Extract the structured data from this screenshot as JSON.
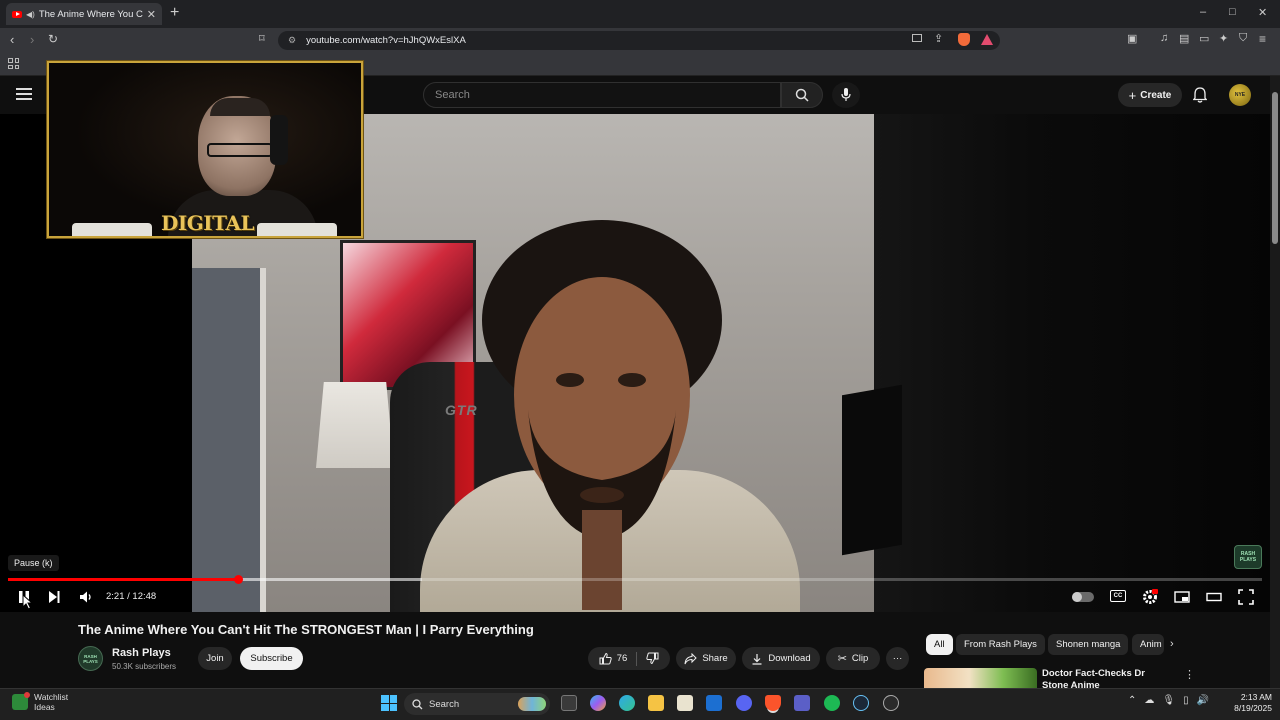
{
  "browser": {
    "tab_title": "The Anime Where You Can't Hit",
    "url": "youtube.com/watch?v=hJhQWxEslXA",
    "window_controls": [
      "–",
      "□",
      "✕"
    ]
  },
  "youtube": {
    "search_placeholder": "Search",
    "create_label": "Create",
    "avatar_text": "NYE"
  },
  "player": {
    "tooltip": "Pause (k)",
    "current_time": "2:21",
    "duration": "12:48",
    "time_display": "2:21 / 12:48",
    "progress_fraction": 0.184,
    "buffer_fraction": 0.33,
    "chair_brand": "GTR",
    "facecam_logo": "DIGITAL",
    "watermark_text": "RASH PLAYS"
  },
  "video": {
    "title": "The Anime Where You Can't Hit The STRONGEST Man | I Parry Everything",
    "channel_name": "Rash Plays",
    "channel_avatar_text": "RASH PLAYS",
    "subscribers": "50.3K subscribers",
    "join_label": "Join",
    "subscribe_label": "Subscribe",
    "likes": "76",
    "share_label": "Share",
    "download_label": "Download",
    "clip_label": "Clip",
    "more_label": "···"
  },
  "sidebar": {
    "chips": [
      "All",
      "From Rash Plays",
      "Shonen manga",
      "Anim"
    ],
    "recommendation_title": "Doctor Fact-Checks Dr Stone Anime"
  },
  "taskbar": {
    "widget_line1": "Watchlist",
    "widget_line2": "Ideas",
    "search_label": "Search",
    "time": "2:13 AM",
    "date": "8/19/2025"
  },
  "colors": {
    "accent_red": "#ff0000",
    "background": "#0f0f0f",
    "chip_bg": "#272727"
  }
}
